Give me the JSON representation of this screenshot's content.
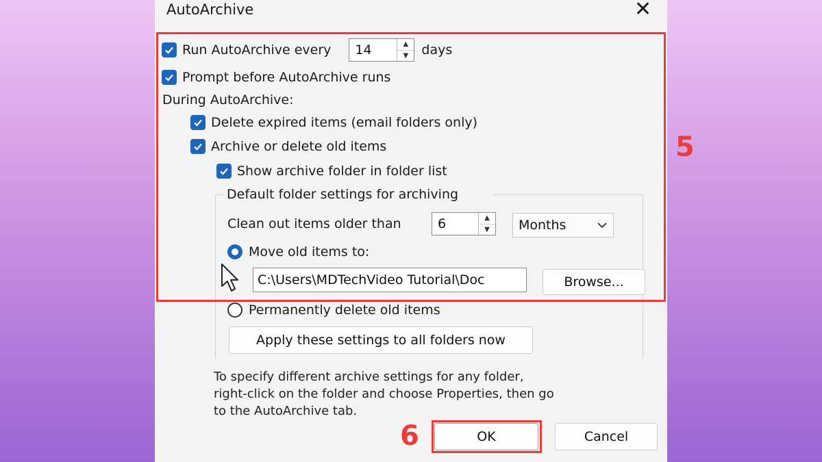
{
  "dialog": {
    "title": "AutoArchive",
    "close_glyph": "✕",
    "run_every": {
      "label": "Run AutoArchive every",
      "value": "14",
      "unit": "days",
      "checked": true
    },
    "prompt_before": {
      "label": "Prompt before AutoArchive runs",
      "checked": true
    },
    "during_label": "During AutoArchive:",
    "delete_expired": {
      "label": "Delete expired items (email folders only)",
      "checked": true
    },
    "archive_old": {
      "label": "Archive or delete old items",
      "checked": true
    },
    "show_folder": {
      "label": "Show archive folder in folder list",
      "checked": true
    },
    "defaults_group": {
      "title": "Default folder settings for archiving",
      "clean_label": "Clean out items older than",
      "clean_value": "6",
      "period_selected": "Months",
      "move_option": {
        "label": "Move old items to:",
        "selected": true
      },
      "move_path": "C:\\Users\\MDTechVideo Tutorial\\Doc",
      "browse_label": "Browse...",
      "permanent_option": {
        "label": "Permanently delete old items",
        "selected": false
      },
      "apply_label": "Apply these settings to all folders now"
    },
    "note_lines": [
      "To specify different archive settings for any folder,",
      "right-click on the folder and choose Properties, then go",
      "to the AutoArchive tab."
    ],
    "ok_label": "OK",
    "cancel_label": "Cancel"
  },
  "annotations": {
    "step_5": "5",
    "step_6": "6",
    "highlight_color": "#ec3b3b"
  },
  "colors": {
    "checkbox_accent": "#1d66bb",
    "dialog_bg": "#f3f3f3"
  },
  "icons": {
    "checkbox": "checkmark-icon",
    "spin": "up-down-arrows-icon",
    "combo": "chevron-down-icon",
    "cursor": "mouse-pointer-icon"
  }
}
